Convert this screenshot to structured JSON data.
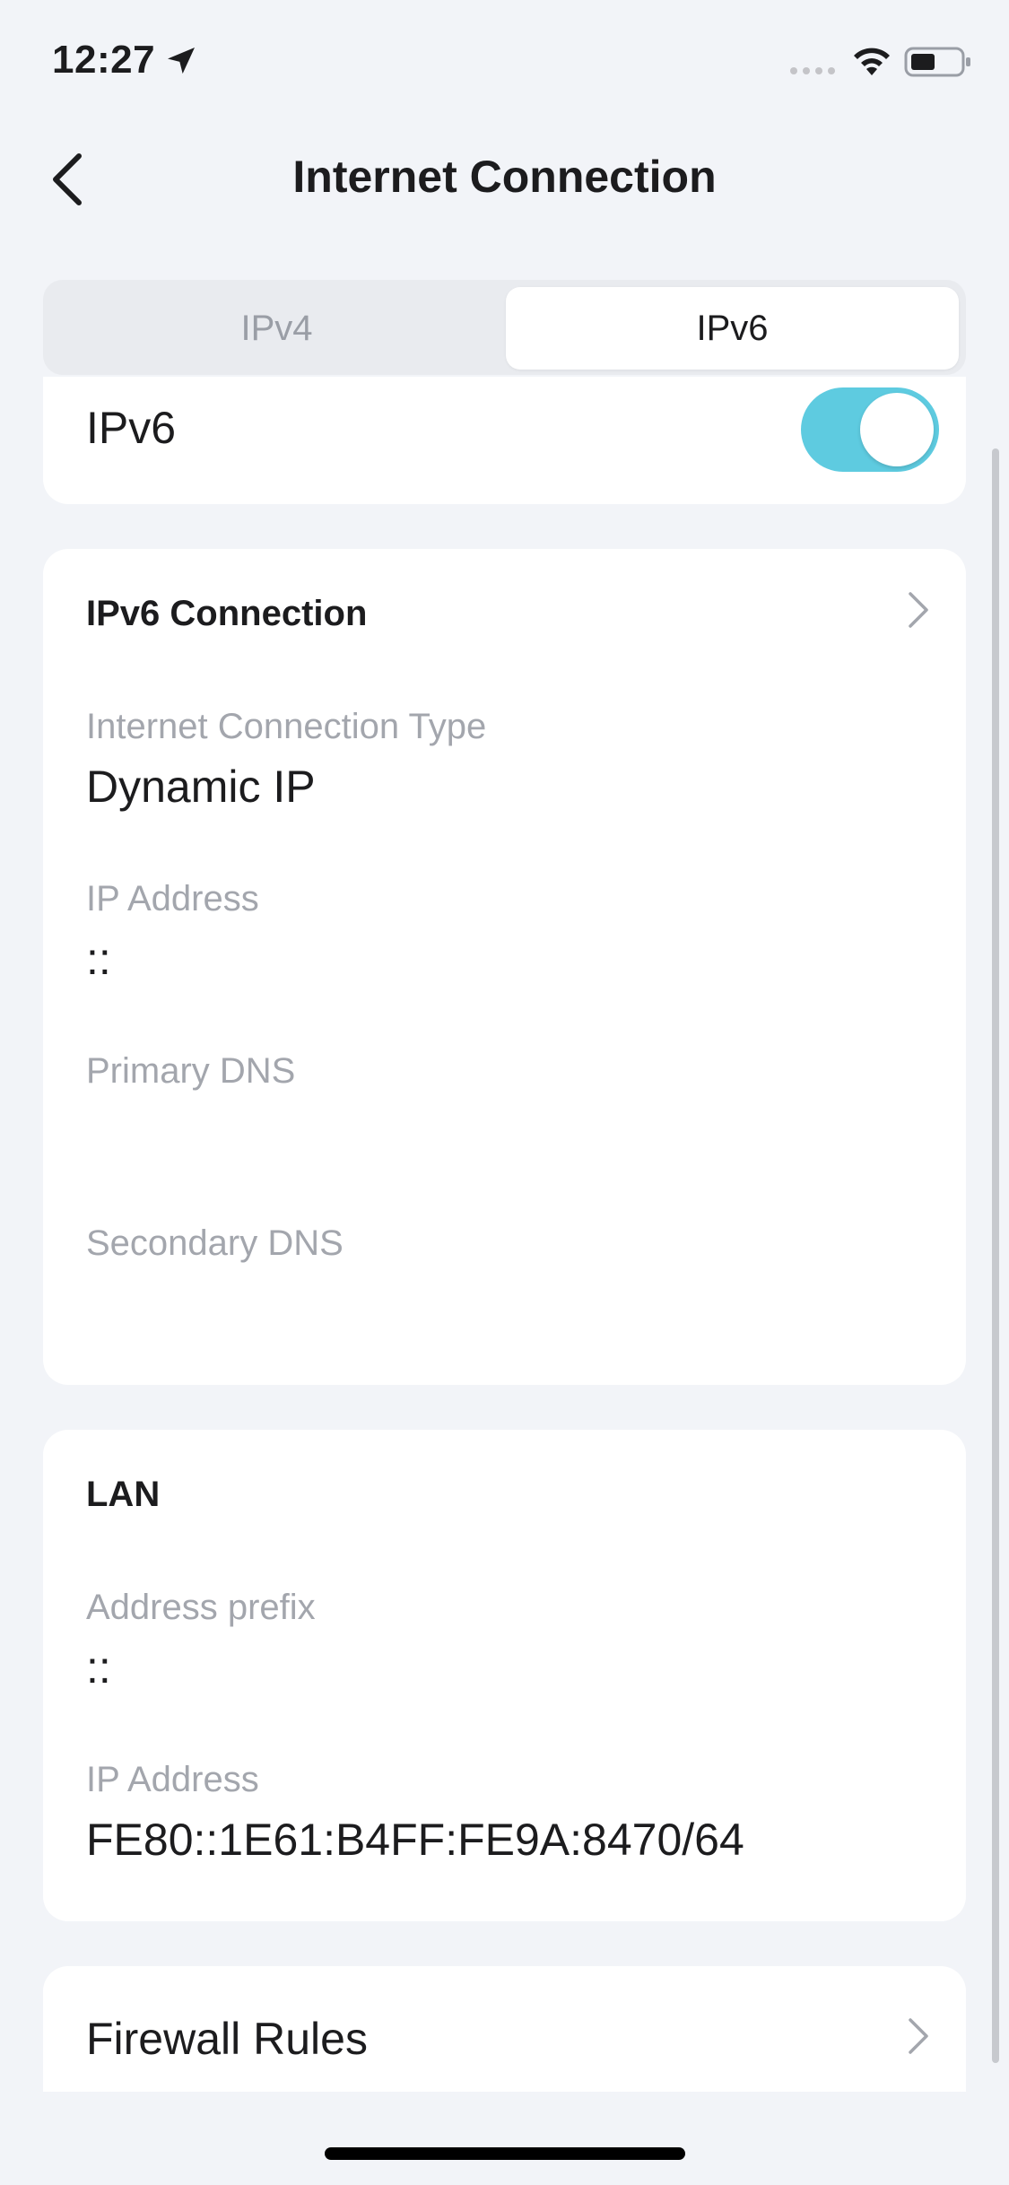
{
  "status_bar": {
    "time": "12:27",
    "location_icon": "location-arrow-icon",
    "signal_icon": "cell-signal-icon",
    "wifi_icon": "wifi-icon",
    "battery_icon": "battery-icon"
  },
  "nav": {
    "back_icon": "chevron-left-icon",
    "title": "Internet Connection"
  },
  "tabs": [
    {
      "label": "IPv4",
      "selected": false
    },
    {
      "label": "IPv6",
      "selected": true
    }
  ],
  "ipv6_toggle": {
    "label": "IPv6",
    "enabled": true
  },
  "connection_card": {
    "header": "IPv6 Connection",
    "fields": [
      {
        "label": "Internet Connection Type",
        "value": "Dynamic IP"
      },
      {
        "label": "IP Address",
        "value": "::"
      },
      {
        "label": "Primary DNS",
        "value": ""
      },
      {
        "label": "Secondary DNS",
        "value": ""
      }
    ]
  },
  "lan_card": {
    "header": "LAN",
    "fields": [
      {
        "label": "Address prefix",
        "value": "::"
      },
      {
        "label": "IP Address",
        "value": "FE80::1E61:B4FF:FE9A:8470/64"
      }
    ]
  },
  "firewall": {
    "label": "Firewall Rules"
  },
  "colors": {
    "background": "#f2f4f8",
    "accent_toggle": "#5ecbe0",
    "label_gray": "#a3a6ad",
    "text_dark": "#1c1c1e"
  }
}
